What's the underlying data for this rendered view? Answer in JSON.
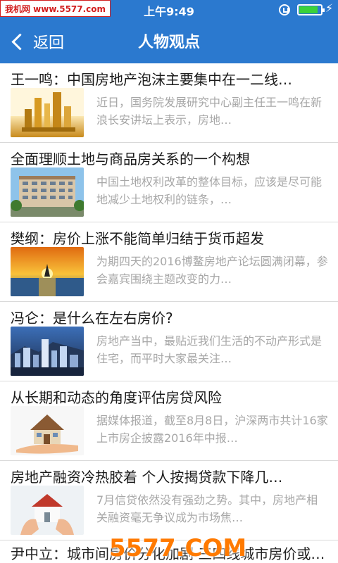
{
  "watermark_top": "我机网 www.5577.com",
  "status": {
    "time": "上午9:49"
  },
  "nav": {
    "back_label": "返回",
    "title": "人物观点"
  },
  "articles": [
    {
      "title": "王一鸣：中国房地产泡沫主要集中在一二线…",
      "summary": "近日，国务院发展研究中心副主任王一鸣在新浪长安讲坛上表示，房地…",
      "image": "gold-buildings"
    },
    {
      "title": "全面理顺土地与商品房关系的一个构想",
      "summary": "中国土地权利改革的整体目标，应该是尽可能地减少土地权利的链条，…",
      "image": "apartment-block"
    },
    {
      "title": "樊纲：房价上涨不能简单归结于货币超发",
      "summary": "为期四天的2016博鳌房地产论坛圆满闭幕，参会嘉宾围绕主题改变的力…",
      "image": "sunset-sea"
    },
    {
      "title": "冯仑：是什么在左右房价?",
      "summary": "房地产当中，最贴近我们生活的不动产形式是住宅，而平时大家最关注…",
      "image": "city-night"
    },
    {
      "title": "从长期和动态的角度评估房贷风险",
      "summary": "据媒体报道，截至8月8日，沪深两市共计16家上市房企披露2016年中报…",
      "image": "house-in-hand"
    },
    {
      "title": "房地产融资冷热胶着 个人按揭贷款下降几…",
      "summary": "7月信贷依然没有强劲之势。其中，房地产相关融资毫无争议成为市场焦…",
      "image": "house-hands"
    }
  ],
  "last_article": {
    "title": "尹中立：城市间房价分化加剧 三四线城市房价或可缓解…"
  },
  "watermark_bottom": "5577.COM"
}
